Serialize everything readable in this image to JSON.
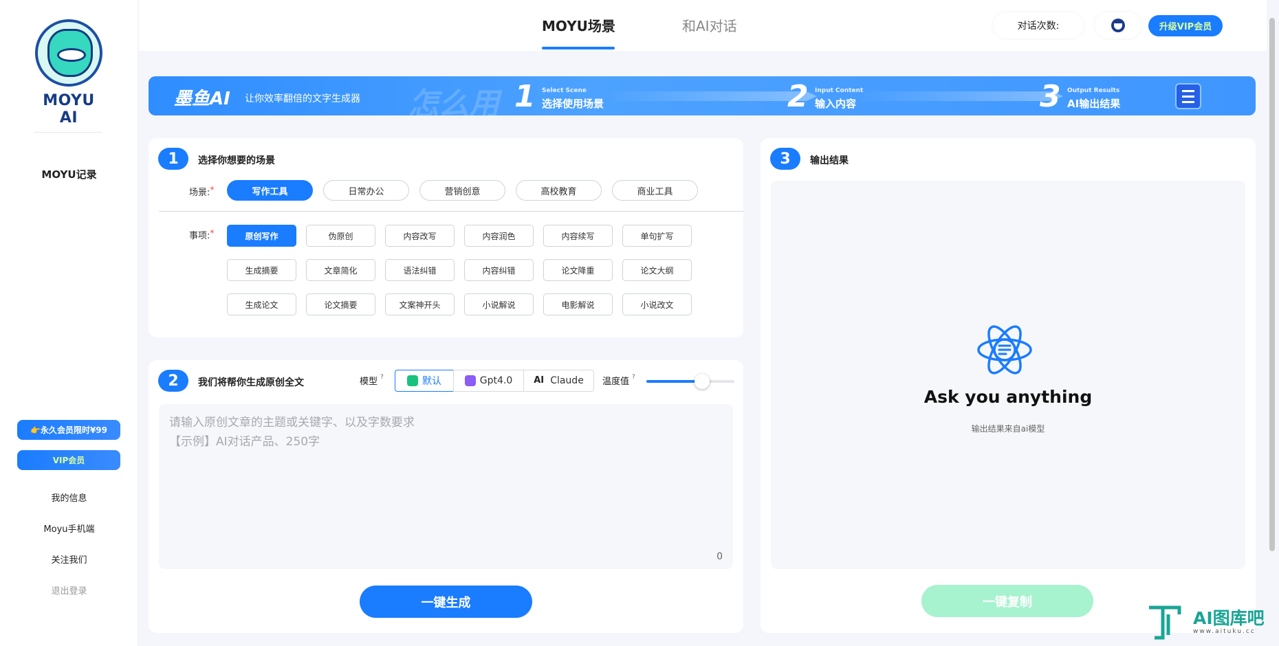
{
  "sidebar": {
    "logo_text": "MOYU AI",
    "record": "MOYU记录",
    "lifetime_promo": "👉永久会员限时¥99",
    "vip_button": "VIP会员",
    "links": [
      "我的信息",
      "Moyu手机端",
      "关注我们"
    ],
    "logout": "退出登录"
  },
  "header": {
    "tabs": [
      "MOYU场景",
      "和AI对话"
    ],
    "chat_count_label": "对话次数:",
    "upgrade": "升级VIP会员"
  },
  "banner": {
    "brand": "墨鱼AI",
    "slogan": "让你效率翻倍的文字生成器",
    "ghost_text": "怎么用",
    "steps": [
      {
        "num": "1",
        "en": "Select Scene",
        "cn": "选择使用场景"
      },
      {
        "num": "2",
        "en": "Input Content",
        "cn": "输入内容"
      },
      {
        "num": "3",
        "en": "Output Results",
        "cn": "AI输出结果"
      }
    ]
  },
  "scene_card": {
    "step": "1",
    "title": "选择你想要的场景",
    "scene_label": "场景:",
    "item_label": "事项:",
    "required_mark": "*",
    "scenes": [
      "写作工具",
      "日常办公",
      "营销创意",
      "高校教育",
      "商业工具"
    ],
    "selected_scene": "写作工具",
    "items": [
      "原创写作",
      "伪原创",
      "内容改写",
      "内容润色",
      "内容续写",
      "单句扩写",
      "生成摘要",
      "文章简化",
      "语法纠错",
      "内容纠错",
      "论文降重",
      "论文大纲",
      "生成论文",
      "论文摘要",
      "文案神开头",
      "小说解说",
      "电影解说",
      "小说改文"
    ],
    "selected_item": "原创写作"
  },
  "input_card": {
    "step": "2",
    "title": "我们将帮你生成原创全文",
    "model_label": "模型",
    "help": "?",
    "models": [
      "默认",
      "Gpt4.0",
      "Claude"
    ],
    "selected_model": "默认",
    "temperature_label": "温度值",
    "temperature": 0.63,
    "placeholder_line1": "请输入原创文章的主题或关键字、以及字数要求",
    "placeholder_line2": "【示例】AI对话产品、250字",
    "char_count": "0",
    "generate": "一键生成"
  },
  "output_card": {
    "step": "3",
    "title": "输出结果",
    "headline": "Ask you anything",
    "subtext": "输出结果来自ai模型",
    "copy": "一键复制"
  },
  "watermark": {
    "title": "AI图库吧",
    "url": "www.aituku.cc"
  },
  "colors": {
    "accent": "#1a7cff",
    "copy_button": "#a7f2cf",
    "vip_text": "#d8ff9e",
    "required": "#ff3b3b"
  },
  "icons": [
    "logo-mascot-icon",
    "avatar-icon",
    "atom-icon",
    "checklist-icon",
    "model-default-icon",
    "model-gpt-icon",
    "model-claude-icon"
  ]
}
